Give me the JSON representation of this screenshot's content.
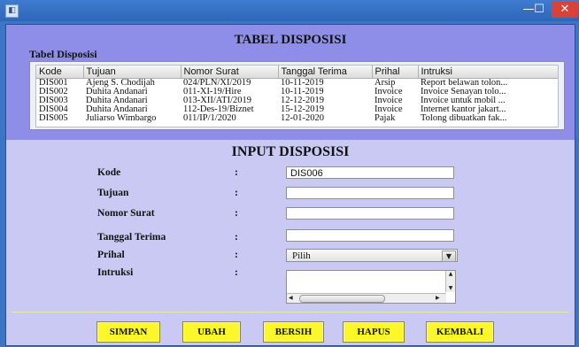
{
  "window": {
    "minimize_glyph": "—",
    "maximize_glyph": "☐",
    "close_glyph": "✕",
    "icon_glyph": "◧"
  },
  "tabel_section": {
    "heading": "TABEL DISPOSISI",
    "subheading": "Tabel Disposisi",
    "columns": [
      "Kode",
      "Tujuan",
      "Nomor Surat",
      "Tanggal Terima",
      "Prihal",
      "Intruksi"
    ],
    "rows": [
      [
        "DIS001",
        "Ajeng S. Chodijah",
        "024/PLN/XI/2019",
        "10-11-2019",
        "Arsip",
        "Report belawan tolon..."
      ],
      [
        "DIS002",
        "Duhita Andanari",
        "011-XI-19/Hire",
        "10-11-2019",
        "Invoice",
        "Invoice Senayan tolo..."
      ],
      [
        "DIS003",
        "Duhita Andanari",
        "013-XII/ATI/2019",
        "12-12-2019",
        "Invoice",
        "Invoice untuk mobil ..."
      ],
      [
        "DIS004",
        "Duhita Andanari",
        "112-Des-19/Biznet",
        "15-12-2019",
        "Invoice",
        "Internet kantor jakart..."
      ],
      [
        "DIS005",
        "Juliarso Wimbargo",
        "011/IP/1/2020",
        "12-01-2020",
        "Pajak",
        "Tolong dibuatkan fak..."
      ]
    ]
  },
  "input_section": {
    "heading": "INPUT DISPOSISI",
    "colon": ":",
    "labels": {
      "kode": "Kode",
      "tujuan": "Tujuan",
      "nomor_surat": "Nomor Surat",
      "tanggal_terima": "Tanggal Terima",
      "prihal": "Prihal",
      "intruksi": "Intruksi"
    },
    "values": {
      "kode": "DIS006",
      "tujuan": "",
      "nomor_surat": "",
      "tanggal_terima": "",
      "prihal_selected": "Pilih",
      "intruksi": ""
    }
  },
  "buttons": {
    "simpan": "SIMPAN",
    "ubah": "UBAH",
    "bersih": "BERSIH",
    "hapus": "HAPUS",
    "kembali": "KEMBALI"
  },
  "colors": {
    "button_bg": "#fbf72a",
    "top_panel_bg": "#8e8ee8",
    "form_bg": "#c9c9f3",
    "title_bar": "#3c74c6",
    "close_button": "#d9423a"
  }
}
